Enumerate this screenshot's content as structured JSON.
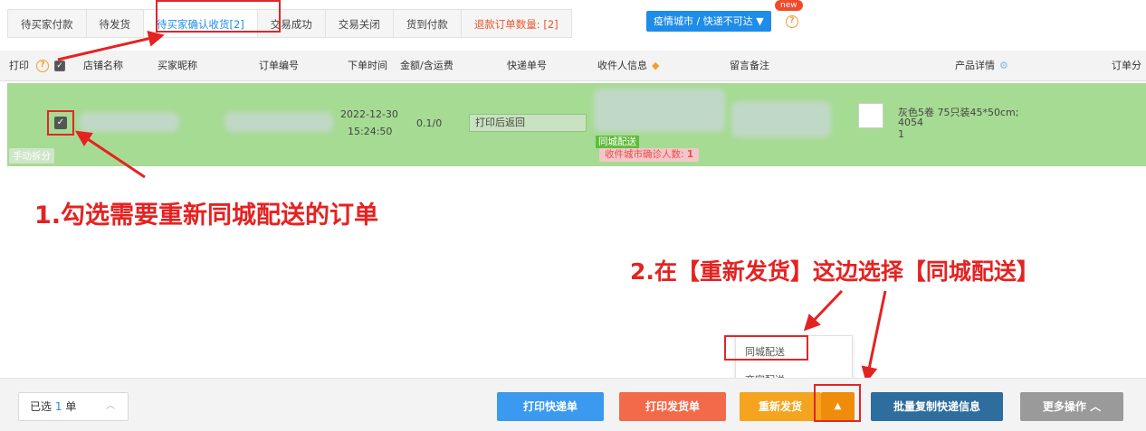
{
  "tabs": [
    {
      "label": "待买家付款"
    },
    {
      "label": "待发货"
    },
    {
      "label": "待买家确认收货[2]"
    },
    {
      "label": "交易成功"
    },
    {
      "label": "交易关闭"
    },
    {
      "label": "货到付款"
    },
    {
      "label": "退款订单数量: [2]"
    }
  ],
  "region_filter": {
    "label": "疫情城市 / 快递不可达 ▼",
    "badge": "new"
  },
  "table": {
    "headers": {
      "print": "打印",
      "shop": "店铺名称",
      "buyer": "买家昵称",
      "order_no": "订单编号",
      "order_time": "下单时间",
      "amount": "金额/含运费",
      "tracking": "快递单号",
      "receiver": "收件人信息",
      "note": "留言备注",
      "product": "产品详情",
      "split": "订单分"
    },
    "row": {
      "split_tag": "手动拆分",
      "date": "2022-12-30",
      "time": "15:24:50",
      "amount": "0.1/0",
      "tracking_placeholder": "打印后返回",
      "city_tag": "同城配送",
      "city_count": "收件城市确诊人数:",
      "city_count_num": "1",
      "product_desc": "灰色5卷 75只装45*50cm;",
      "product_code": "4054",
      "product_qty": "1"
    }
  },
  "annotations": {
    "step1": "1.勾选需要重新同城配送的订单",
    "step2": "2.在【重新发货】这边选择【同城配送】"
  },
  "dropdown": {
    "items": [
      "同城配送",
      "商家配送"
    ]
  },
  "footer": {
    "selected_prefix": "已选",
    "selected_count": "1",
    "selected_suffix": "单",
    "btn_print_express": "打印快递单",
    "btn_print_ship": "打印发货单",
    "btn_reship": "重新发货",
    "btn_reship_toggle": "▲",
    "btn_batch_copy": "批量复制快递信息",
    "btn_more": "更多操作 ︿"
  },
  "colors": {
    "accent": "#1f8fe8",
    "row_bg": "#a6db93",
    "annotation": "#e52222"
  }
}
